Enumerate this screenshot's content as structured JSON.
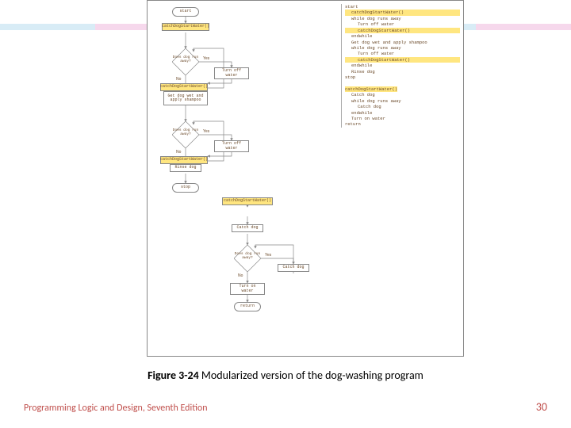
{
  "caption": {
    "fig": "Figure 3-24",
    "text": " Modularized version of the dog-washing program"
  },
  "footer": {
    "left": "Programming Logic and Design, Seventh Edition",
    "page": "30"
  },
  "flow": {
    "start": "start",
    "call1": "catchDogStartWater()",
    "dec1": "Does dog run away?",
    "yes": "Yes",
    "no": "No",
    "off1": "Turn off water",
    "call2": "catchDogStartWater()",
    "wet": "Get dog wet and apply shampoo",
    "dec2": "Does dog run away?",
    "off2": "Turn off water",
    "call3": "catchDogStartWater()",
    "rinse": "Rinse dog",
    "stop": "stop",
    "sub_head": "catchDogStartWater()",
    "catch1": "Catch dog",
    "dec3": "Does dog run away?",
    "catch2": "Catch dog",
    "turnon": "Turn on water",
    "return": "return"
  },
  "pseudo": {
    "l0": "start",
    "l1": "catchDogStartWater()",
    "l2": "while dog runs away",
    "l3": "Turn off water",
    "l4": "catchDogStartWater()",
    "l5": "endwhile",
    "l6": "Get dog wet and apply shampoo",
    "l7": "while dog runs away",
    "l8": "Turn off water",
    "l9": "catchDogStartWater()",
    "l10": "endwhile",
    "l11": "Rinse dog",
    "l12": "stop",
    "s0": "catchDogStartWater()",
    "s1": "Catch dog",
    "s2": "while dog runs away",
    "s3": "Catch dog",
    "s4": "endwhile",
    "s5": "Turn on water",
    "s6": "return"
  }
}
